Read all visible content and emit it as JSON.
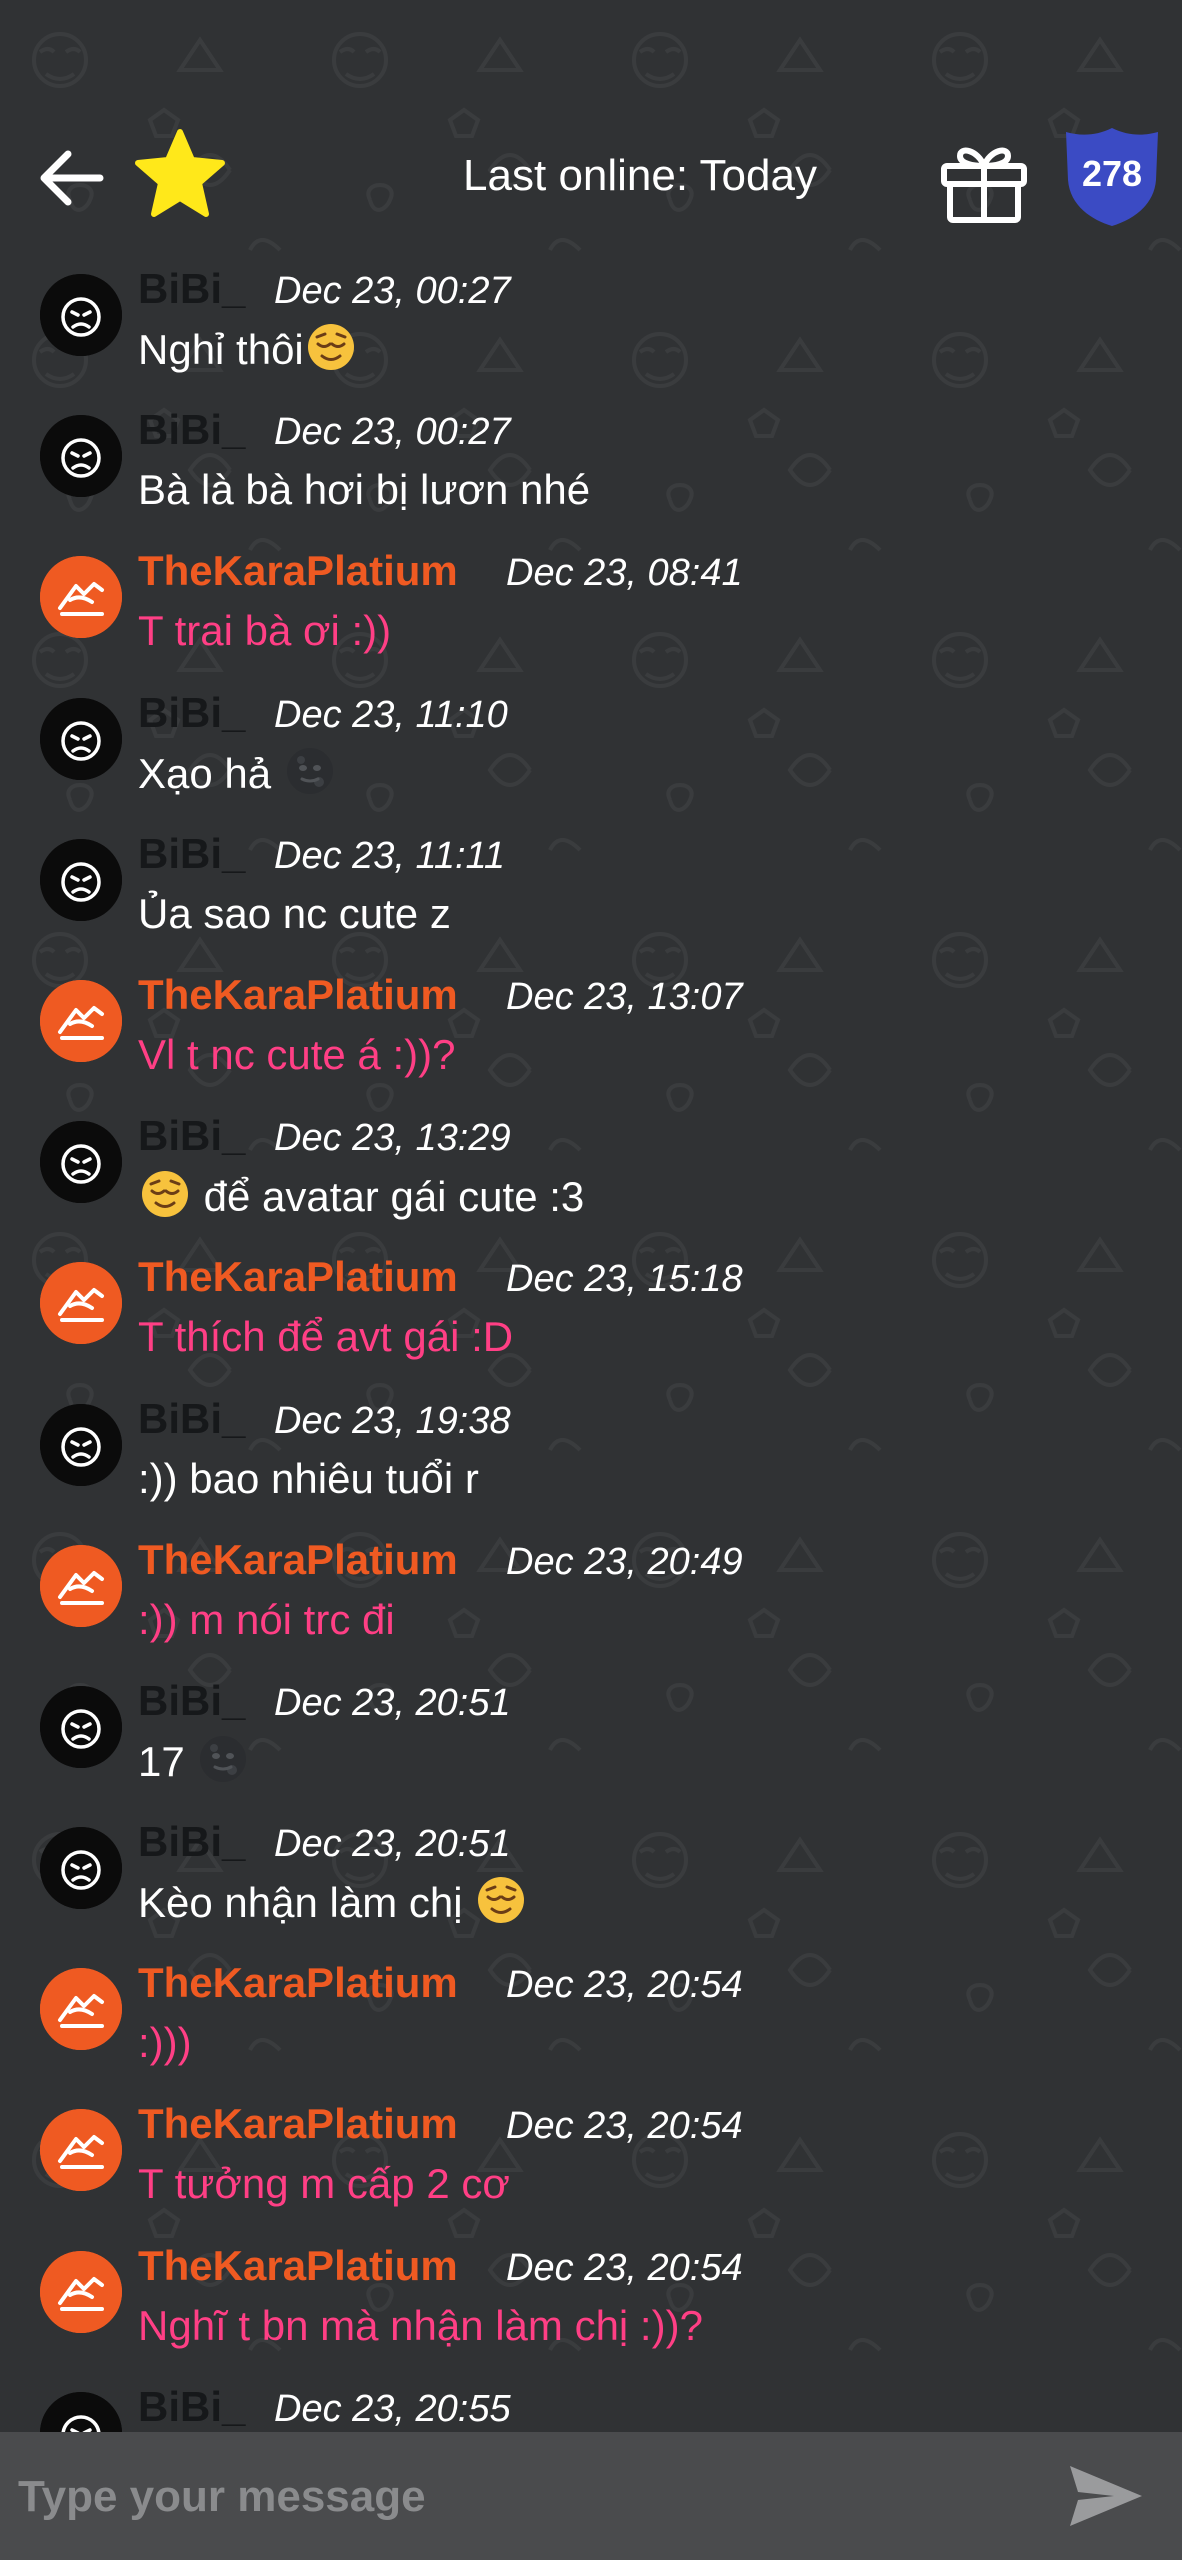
{
  "header": {
    "back_icon": "arrow-left-icon",
    "favorite_icon": "star-icon",
    "status_text": "Last online: Today",
    "gift_icon": "gift-icon",
    "badge_count": "278"
  },
  "colors": {
    "background": "#303234",
    "bibi_name": "#16181a",
    "kara_name": "#ef5a22",
    "kara_text": "#ff3f85",
    "badge": "#3b4bc4",
    "star": "#ffe81a",
    "input_bar": "#4a4b4d"
  },
  "messages": [
    {
      "sender": "BiBi_",
      "time": "Dec 23, 00:27",
      "text": "Nghỉ thôi",
      "emoji_after": "relieved-face-emoji"
    },
    {
      "sender": "BiBi_",
      "time": "Dec 23, 00:27",
      "text": "Bà là bà hơi bị lươn nhé"
    },
    {
      "sender": "TheKaraPlatium",
      "time": "Dec 23, 08:41",
      "text": "T trai bà ơi :))"
    },
    {
      "sender": "BiBi_",
      "time": "Dec 23, 11:10",
      "text": "Xạo hả",
      "emoji_after": "new-moon-face-emoji"
    },
    {
      "sender": "BiBi_",
      "time": "Dec 23, 11:11",
      "text": "Ủa sao nc cute z"
    },
    {
      "sender": "TheKaraPlatium",
      "time": "Dec 23, 13:07",
      "text": "Vl t nc cute á :))?"
    },
    {
      "sender": "BiBi_",
      "time": "Dec 23, 13:29",
      "text": "để avatar gái cute :3",
      "emoji_before": "relieved-face-emoji"
    },
    {
      "sender": "TheKaraPlatium",
      "time": "Dec 23, 15:18",
      "text": "T thích để avt gái :D"
    },
    {
      "sender": "BiBi_",
      "time": "Dec 23, 19:38",
      "text": ":)) bao nhiêu tuổi r"
    },
    {
      "sender": "TheKaraPlatium",
      "time": "Dec 23, 20:49",
      "text": ":)) m nói trc đi"
    },
    {
      "sender": "BiBi_",
      "time": "Dec 23, 20:51",
      "text": "17",
      "emoji_after": "new-moon-face-emoji"
    },
    {
      "sender": "BiBi_",
      "time": "Dec 23, 20:51",
      "text": "Kèo nhận làm chị",
      "emoji_after": "relieved-face-emoji"
    },
    {
      "sender": "TheKaraPlatium",
      "time": "Dec 23, 20:54",
      "text": ":)))"
    },
    {
      "sender": "TheKaraPlatium",
      "time": "Dec 23, 20:54",
      "text": "T tưởng m cấp 2 cơ"
    },
    {
      "sender": "TheKaraPlatium",
      "time": "Dec 23, 20:54",
      "text": "Nghĩ t bn mà nhận làm chị :))?"
    },
    {
      "sender": "BiBi_",
      "time": "Dec 23, 20:55",
      "text": ""
    }
  ],
  "composer": {
    "placeholder": "Type your message",
    "send_icon": "send-icon"
  }
}
